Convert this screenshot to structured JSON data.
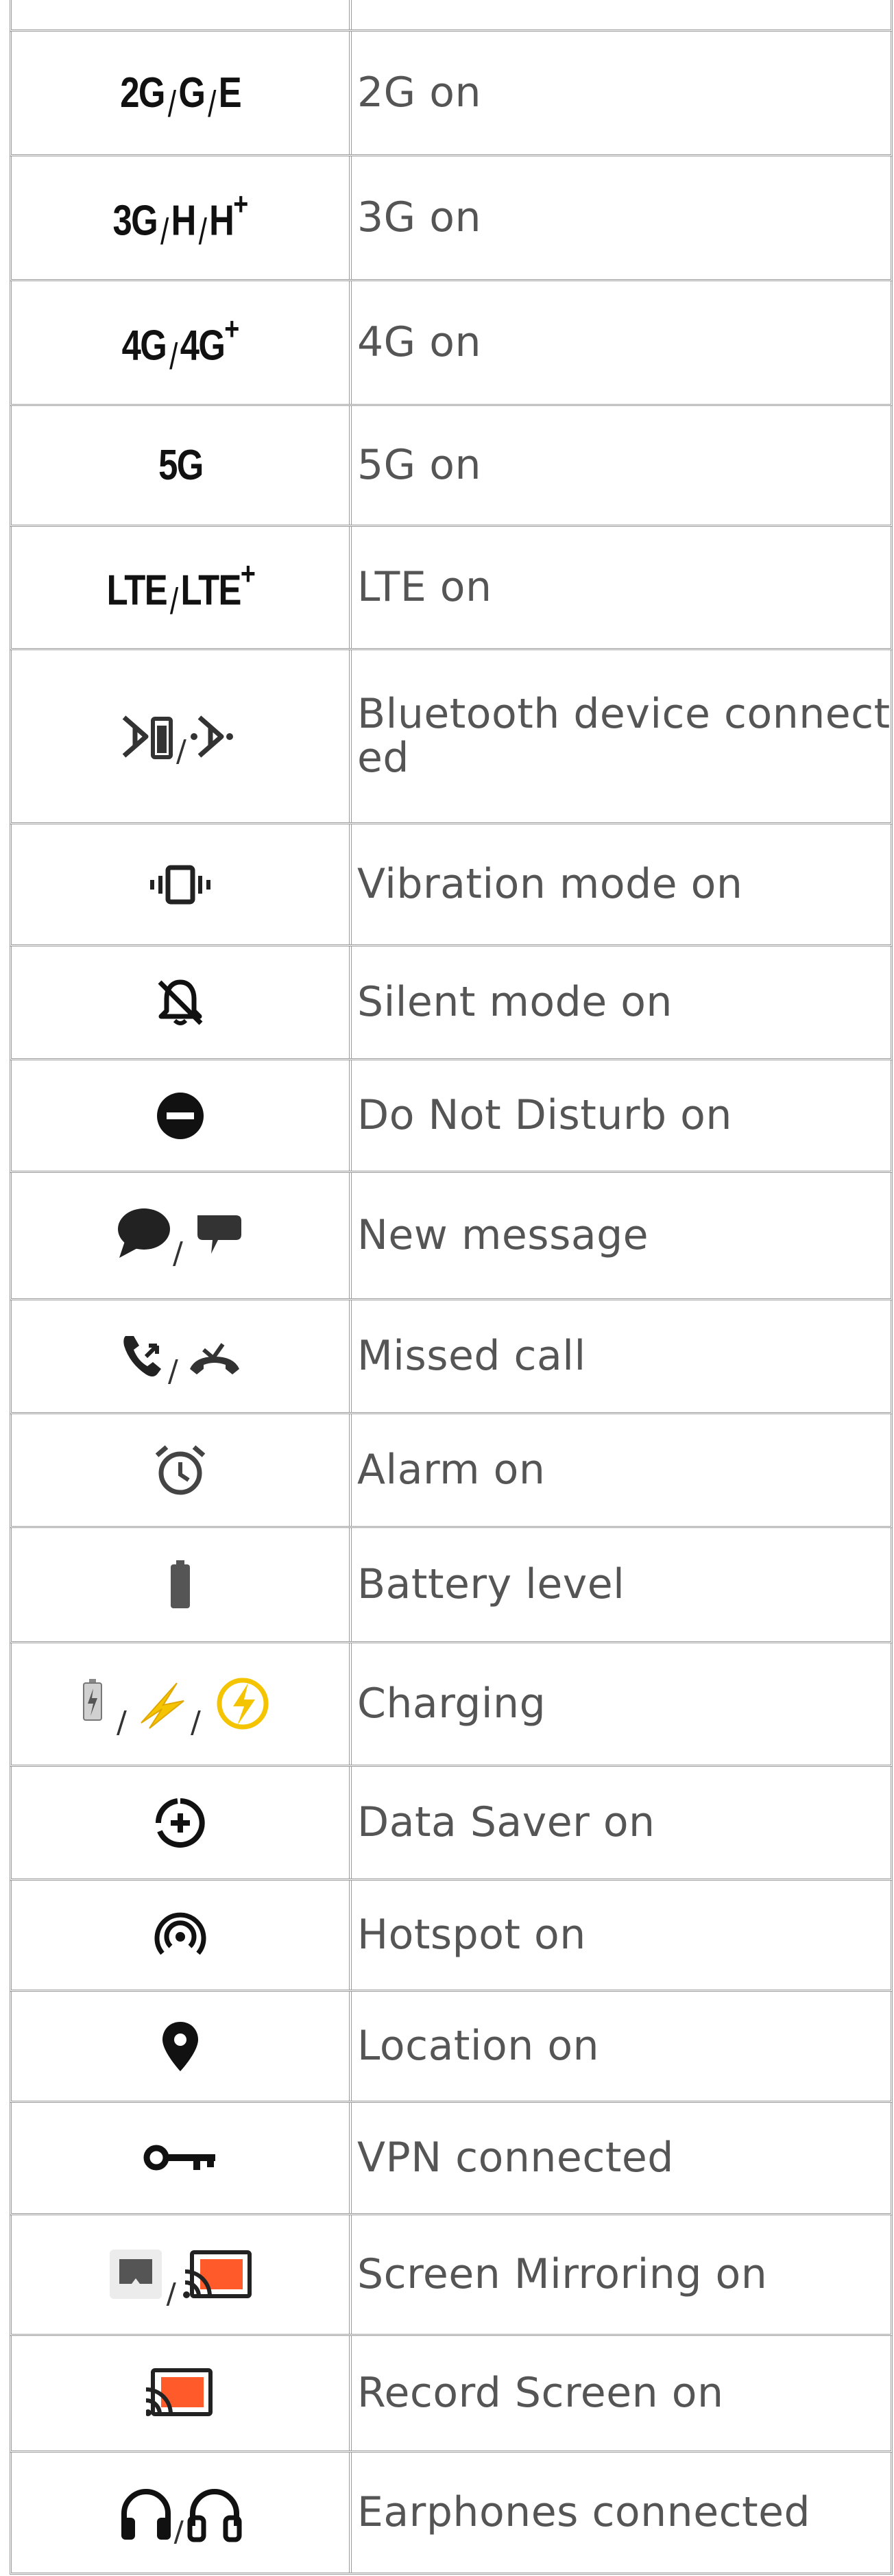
{
  "rows": [
    {
      "icon": "",
      "label": ""
    },
    {
      "icon": "network-2g-g-e-icon",
      "label": "2G on",
      "icon_text": [
        "2G",
        "G",
        "E"
      ]
    },
    {
      "icon": "network-3g-h-hplus-icon",
      "label": "3G on",
      "icon_text": [
        "3G",
        "H",
        "H"
      ]
    },
    {
      "icon": "network-4g-4gplus-icon",
      "label": "4G on",
      "icon_text": [
        "4G",
        "4G"
      ]
    },
    {
      "icon": "network-5g-icon",
      "label": "5G on",
      "icon_text": [
        "5G"
      ]
    },
    {
      "icon": "network-lte-lteplus-icon",
      "label": "LTE on",
      "icon_text": [
        "LTE",
        "LTE"
      ]
    },
    {
      "icon": "bluetooth-connected-icon",
      "label": "Bluetooth device connected"
    },
    {
      "icon": "vibration-icon",
      "label": "Vibration mode on"
    },
    {
      "icon": "silent-mode-icon",
      "label": "Silent mode on"
    },
    {
      "icon": "do-not-disturb-icon",
      "label": "Do Not Disturb on"
    },
    {
      "icon": "message-icon",
      "label": "New message"
    },
    {
      "icon": "missed-call-icon",
      "label": "Missed call"
    },
    {
      "icon": "alarm-icon",
      "label": "Alarm on"
    },
    {
      "icon": "battery-icon",
      "label": "Battery level"
    },
    {
      "icon": "charging-icon",
      "label": "Charging"
    },
    {
      "icon": "data-saver-icon",
      "label": "Data Saver on"
    },
    {
      "icon": "hotspot-icon",
      "label": "Hotspot on"
    },
    {
      "icon": "location-icon",
      "label": "Location on"
    },
    {
      "icon": "vpn-key-icon",
      "label": "VPN connected"
    },
    {
      "icon": "screen-mirroring-icon",
      "label": "Screen Mirroring on"
    },
    {
      "icon": "screen-record-icon",
      "label": "Record Screen on"
    },
    {
      "icon": "earphones-icon",
      "label": "Earphones connected"
    }
  ],
  "colors": {
    "border": "#9a9a9a",
    "text": "#555555",
    "charging_yellow": "#f5c400",
    "cast_orange": "#ff5a2a"
  }
}
